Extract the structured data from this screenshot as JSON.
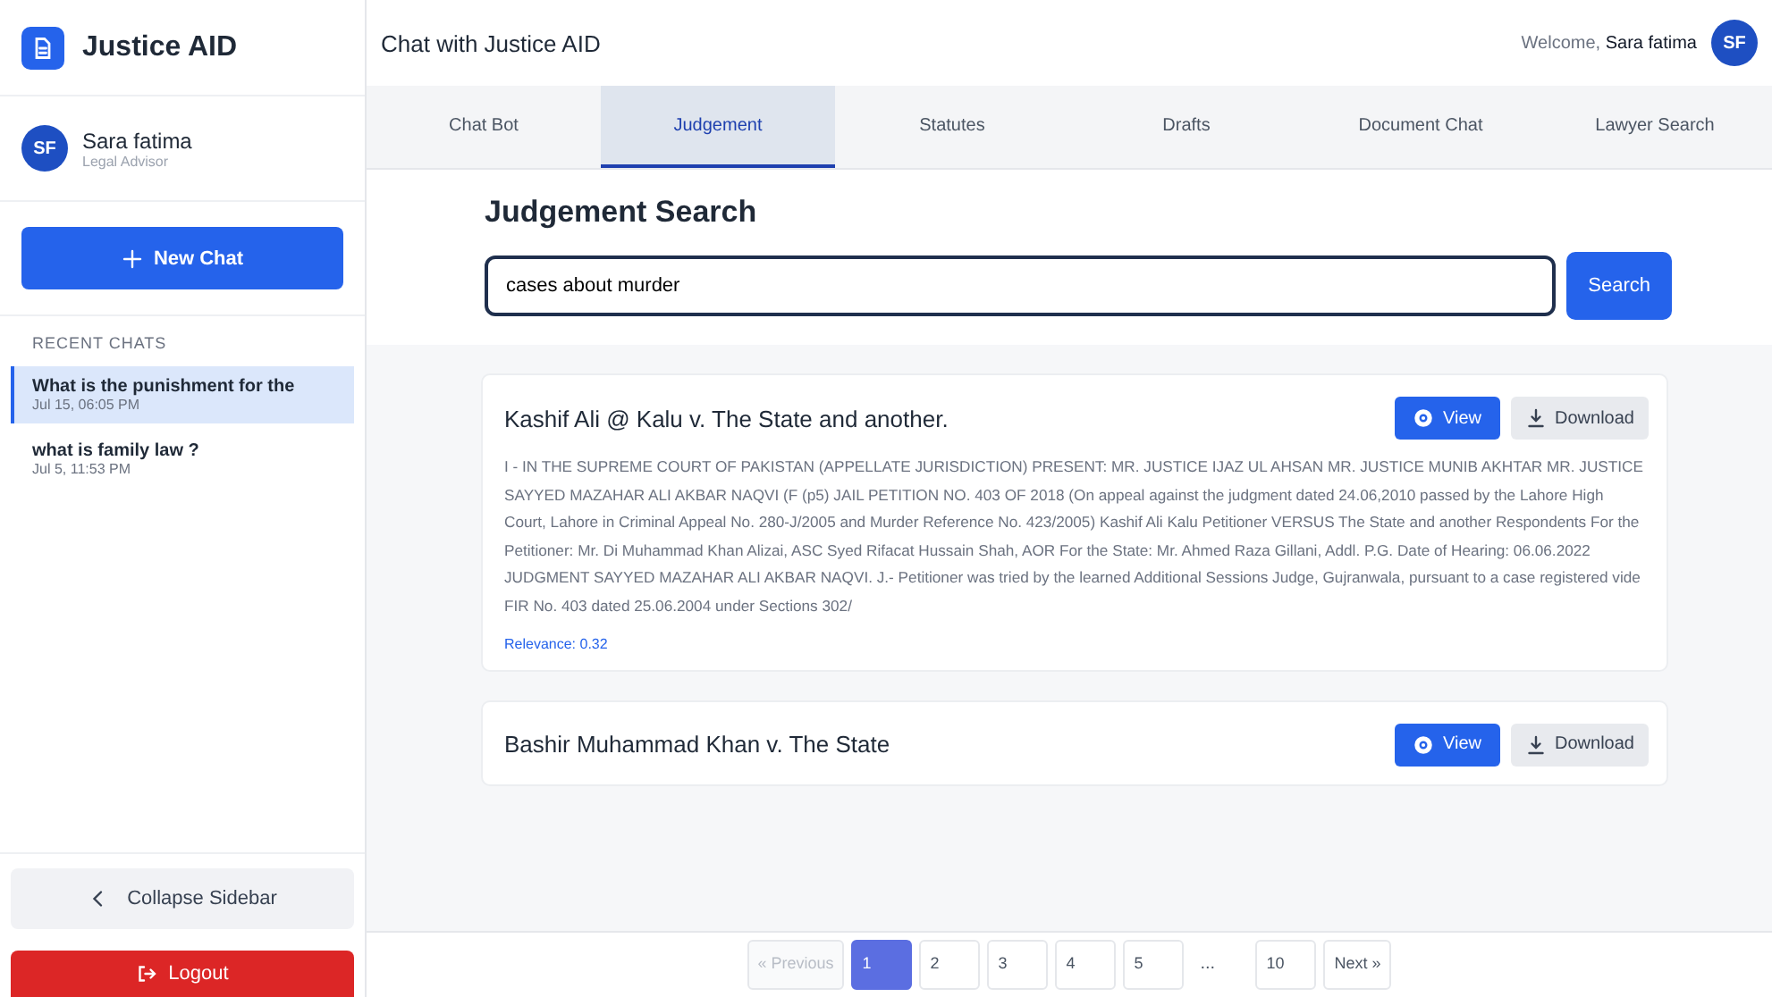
{
  "app": {
    "title": "Justice AID"
  },
  "user": {
    "initials": "SF",
    "name": "Sara fatima",
    "role": "Legal Advisor"
  },
  "new_chat": {
    "label": "New Chat"
  },
  "recent_chats": {
    "heading": "RECENT CHATS",
    "items": [
      {
        "title": "What is the punishment for the",
        "time": "Jul 15, 06:05 PM",
        "selected": true
      },
      {
        "title": "what is family law ?",
        "time": "Jul 5, 11:53 PM",
        "selected": false
      }
    ]
  },
  "collapse": {
    "label": "Collapse Sidebar"
  },
  "logout": {
    "label": "Logout"
  },
  "header": {
    "title": "Chat with Justice AID",
    "welcome": "Welcome,",
    "user_name": "Sara fatima",
    "initials": "SF"
  },
  "tabs": [
    {
      "label": "Chat Bot",
      "selected": false
    },
    {
      "label": "Judgement",
      "selected": true
    },
    {
      "label": "Statutes",
      "selected": false
    },
    {
      "label": "Drafts",
      "selected": false
    },
    {
      "label": "Document Chat",
      "selected": false
    },
    {
      "label": "Lawyer Search",
      "selected": false
    }
  ],
  "search": {
    "heading": "Judgement Search",
    "value": "cases about murder",
    "button": "Search"
  },
  "results": [
    {
      "title": "Kashif Ali @ Kalu v. The State and another.",
      "view": "View",
      "download": "Download",
      "excerpt": "I - IN THE SUPREME COURT OF PAKISTAN (APPELLATE JURISDICTION) PRESENT: MR. JUSTICE IJAZ UL AHSAN MR. JUSTICE MUNIB AKHTAR MR. JUSTICE SAYYED MAZAHAR ALI AKBAR NAQVI (F (p5) JAIL PETITION NO. 403 OF 2018 (On appeal against the judgment dated 24.06,2010 passed by the Lahore High Court, Lahore in Criminal Appeal No. 280-J/2005 and Murder Reference No. 423/2005) Kashif Ali Kalu Petitioner VERSUS The State and another Respondents For the Petitioner: Mr. Di Muhammad Khan Alizai, ASC Syed Rifacat Hussain Shah, AOR For the State: Mr. Ahmed Raza Gillani, Addl. P.G. Date of Hearing: 06.06.2022 JUDGMENT SAYYED MAZAHAR ALI AKBAR NAQVI. J.- Petitioner was tried by the learned Additional Sessions Judge, Gujranwala, pursuant to a case registered vide FIR No. 403 dated 25.06.2004 under Sections 302/",
      "relevance": "Relevance: 0.32"
    },
    {
      "title": "Bashir Muhammad Khan v. The State",
      "view": "View",
      "download": "Download"
    }
  ],
  "pagination": [
    {
      "label": "« Previous",
      "kind": "prev",
      "disabled": true,
      "selected": false
    },
    {
      "label": "1",
      "kind": "page",
      "disabled": false,
      "selected": true
    },
    {
      "label": "2",
      "kind": "page",
      "disabled": false,
      "selected": false
    },
    {
      "label": "3",
      "kind": "page",
      "disabled": false,
      "selected": false
    },
    {
      "label": "4",
      "kind": "page",
      "disabled": false,
      "selected": false
    },
    {
      "label": "5",
      "kind": "page",
      "disabled": false,
      "selected": false
    },
    {
      "label": "...",
      "kind": "gap"
    },
    {
      "label": "10",
      "kind": "page",
      "disabled": false,
      "selected": false
    },
    {
      "label": "Next »",
      "kind": "next",
      "disabled": false,
      "selected": false
    }
  ]
}
